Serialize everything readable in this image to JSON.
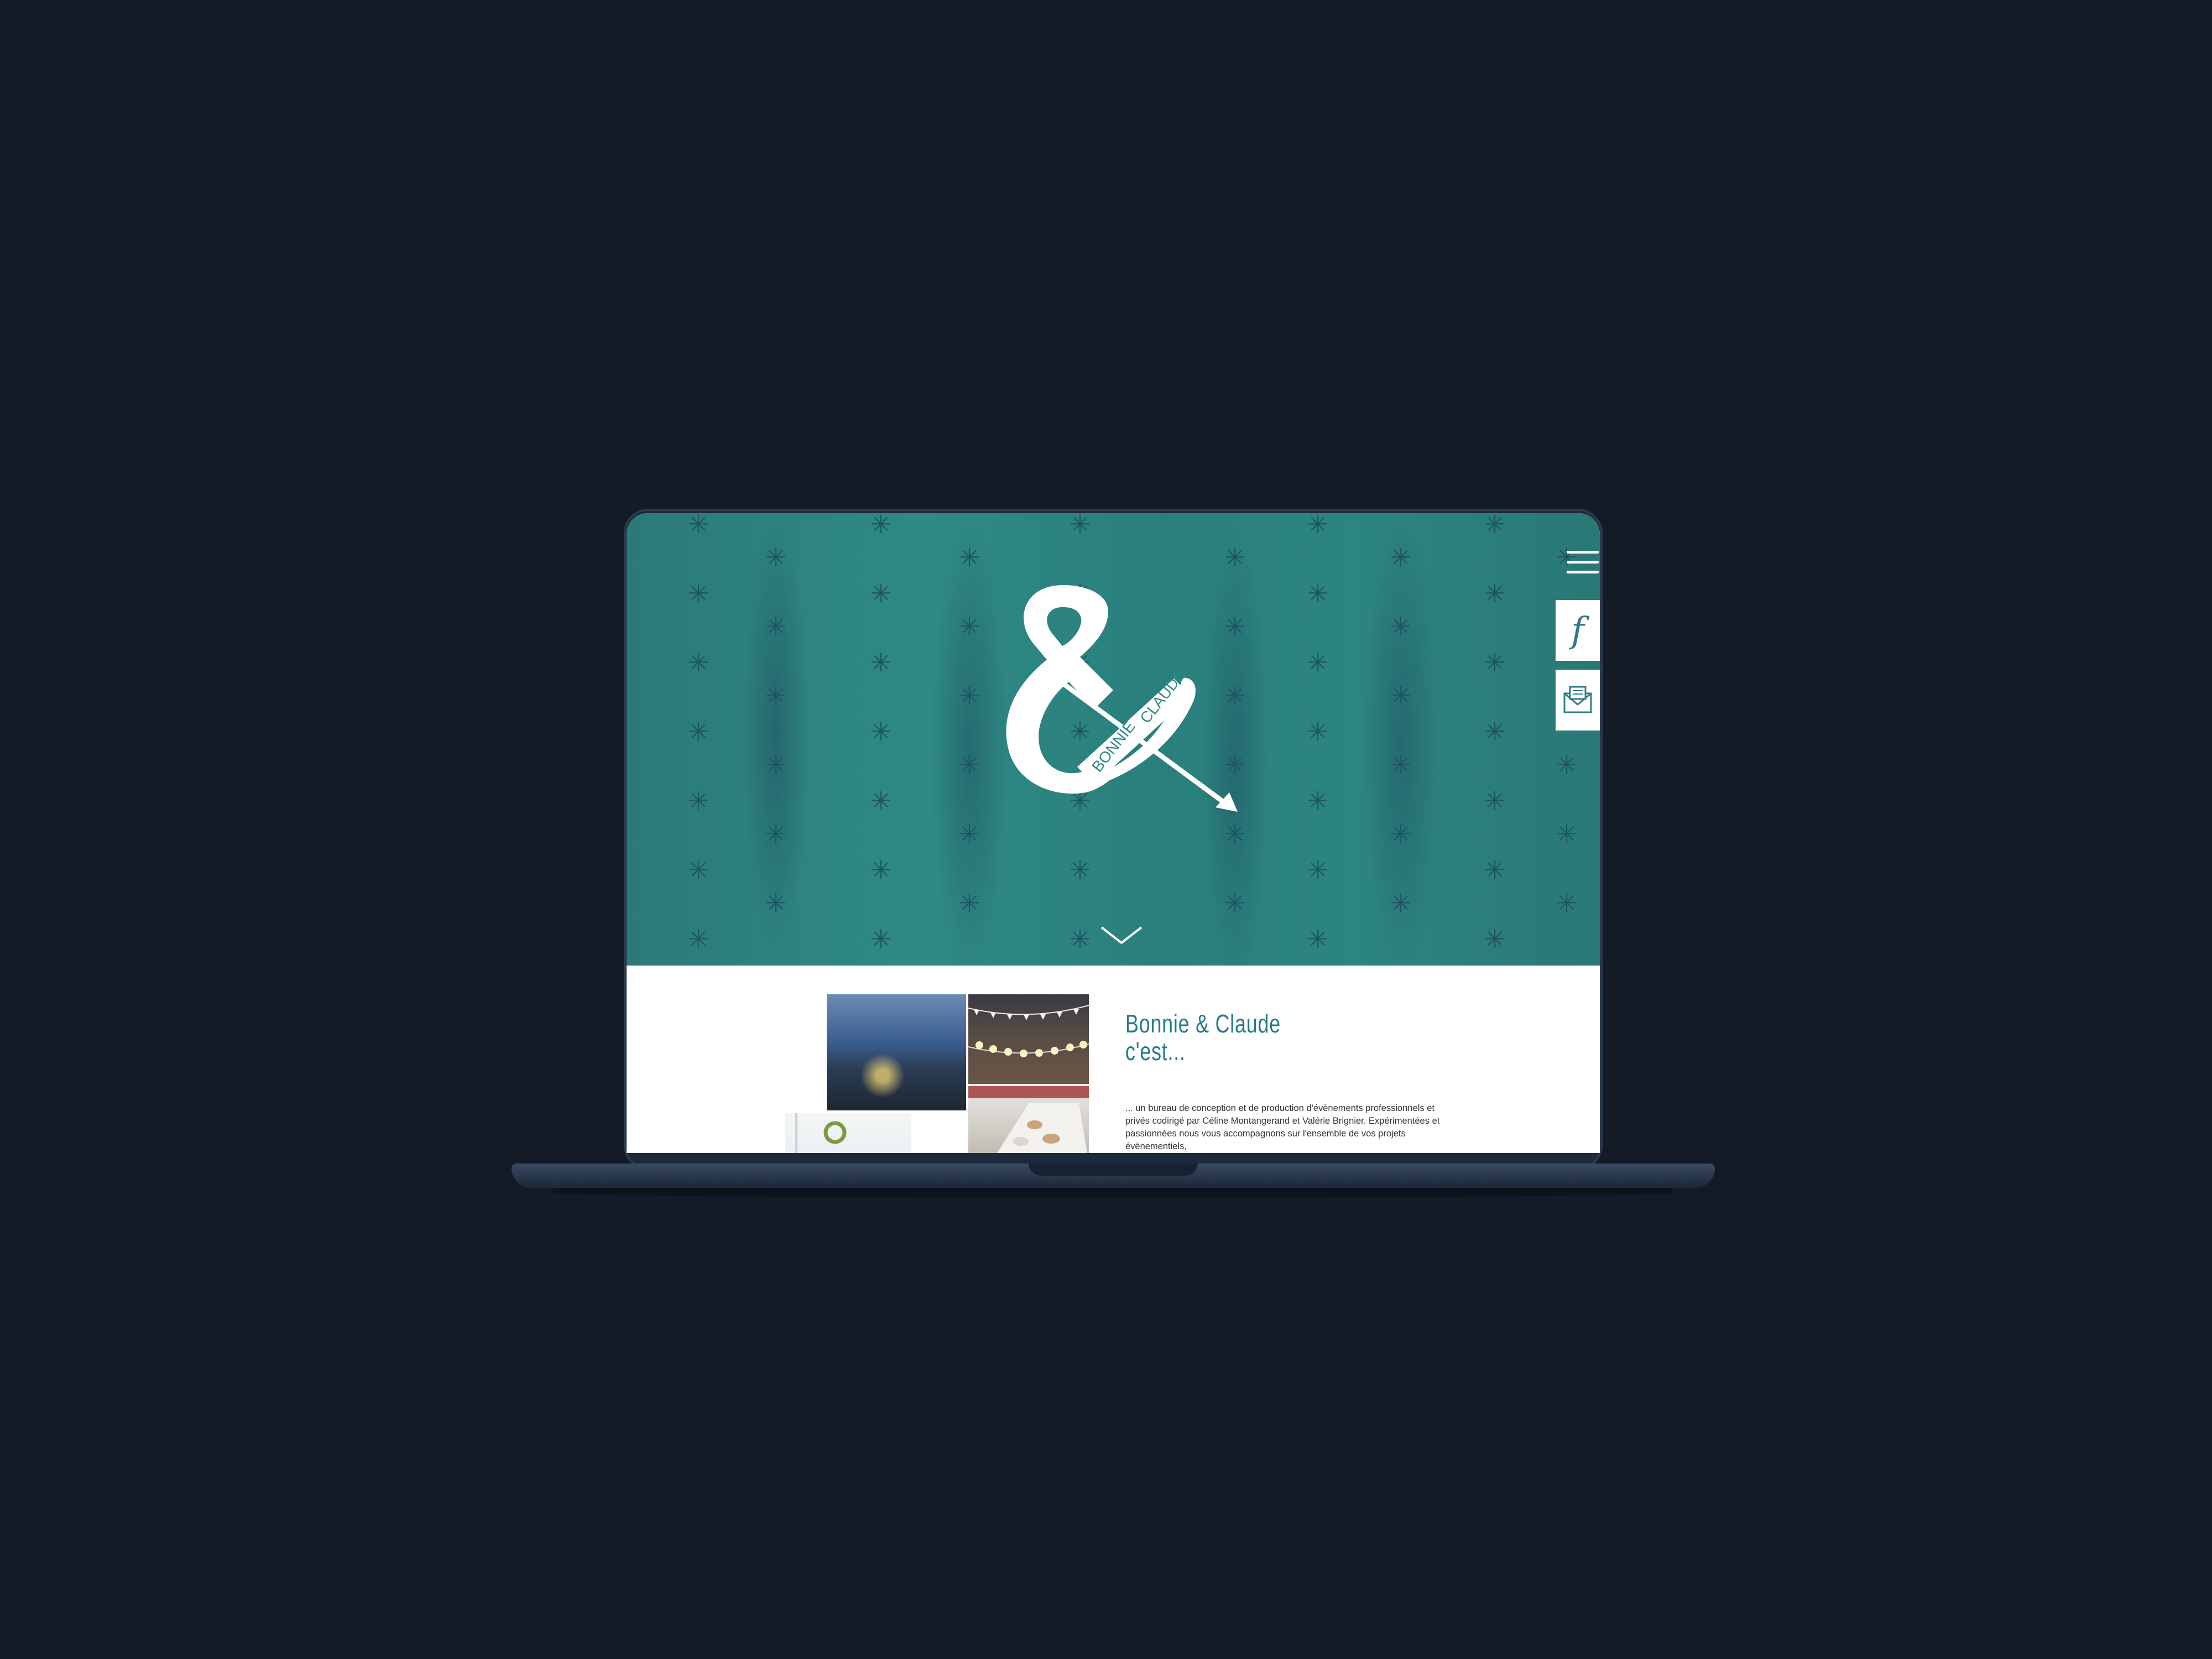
{
  "hero": {
    "logo_text_1": "BONNIE",
    "logo_text_2": "CLAUDE",
    "accent_color": "#2f8a84"
  },
  "nav": {
    "menu_icon": "hamburger-menu-icon",
    "facebook_icon": "facebook-icon",
    "mail_icon": "mail-icon",
    "facebook_letter": "f"
  },
  "about": {
    "title_line1": "Bonnie & Claude",
    "title_line2": "c'est...",
    "body": "... un bureau de conception et de production d'évènements professionnels et privés codirigé par Céline Montangerand et Valérie Brignier. Expérimentées et passionnées nous vous accompagnons sur l'ensemble de vos projets évènementiels,",
    "title_color": "#247a87"
  }
}
